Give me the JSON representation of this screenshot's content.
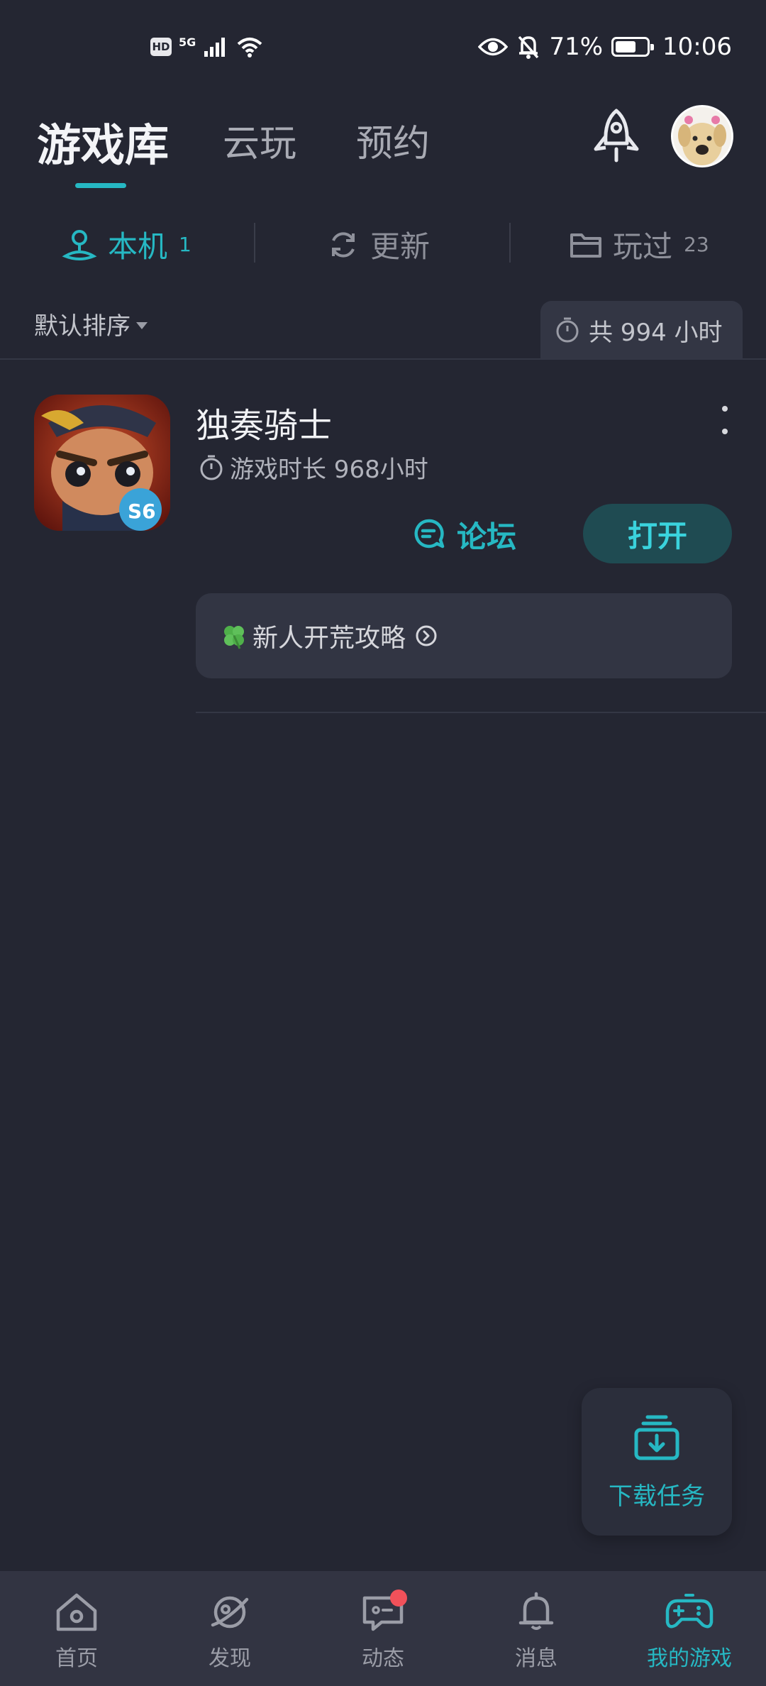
{
  "status_bar": {
    "hd": "HD",
    "network": "5G",
    "battery_percent": "71%",
    "battery_level": 0.71,
    "time": "10:06"
  },
  "header": {
    "tabs": [
      {
        "label": "游戏库",
        "active": true
      },
      {
        "label": "云玩",
        "active": false
      },
      {
        "label": "预约",
        "active": false
      }
    ],
    "icons": [
      "rocket-icon",
      "avatar"
    ]
  },
  "sub_tabs": [
    {
      "label": "本机",
      "count": "1",
      "icon": "local-device-icon",
      "active": true
    },
    {
      "label": "更新",
      "count": "",
      "icon": "refresh-icon",
      "active": false
    },
    {
      "label": "玩过",
      "count": "23",
      "icon": "folder-icon",
      "active": false
    }
  ],
  "sort": {
    "label": "默认排序",
    "total_label": "共 994 小时"
  },
  "games": [
    {
      "title": "独奏骑士",
      "play_time": "游戏时长 968小时",
      "forum_label": "论坛",
      "open_label": "打开",
      "guide_label": "新人开荒攻略"
    }
  ],
  "download": {
    "label": "下载任务"
  },
  "bottom_nav": [
    {
      "label": "首页",
      "icon": "home-icon",
      "active": false
    },
    {
      "label": "发现",
      "icon": "planet-icon",
      "active": false
    },
    {
      "label": "动态",
      "icon": "chat-icon",
      "active": false,
      "badge": true
    },
    {
      "label": "消息",
      "icon": "bell-icon",
      "active": false
    },
    {
      "label": "我的游戏",
      "icon": "gamepad-icon",
      "active": true
    }
  ],
  "colors": {
    "background": "#242632",
    "accent": "#26b8c3",
    "nav_background": "#323442",
    "badge": "#f1515a"
  }
}
